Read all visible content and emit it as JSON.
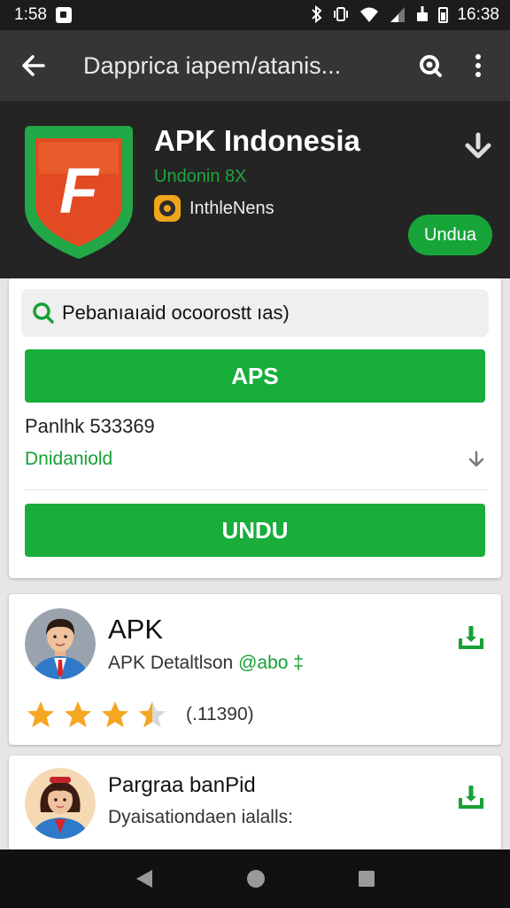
{
  "status_bar": {
    "time_left": "1:58",
    "time_right": "16:38",
    "icons": [
      "notification-icon",
      "bluetooth-icon",
      "vibrate-icon",
      "wifi-icon",
      "signal-icon",
      "battery-icon"
    ]
  },
  "app_bar": {
    "title": "Dapprica iapem/atanis...",
    "icons": [
      "back-arrow-icon",
      "search-icon",
      "more-vert-icon"
    ]
  },
  "header": {
    "app_name": "APK Indonesia",
    "subline": "Undonin 8X",
    "developer": "InthleNens",
    "install_button": "Undua",
    "logo_letter": "F",
    "colors": {
      "background": "#242424",
      "accent": "#17a53a"
    }
  },
  "main_card": {
    "search_text": "Pebanıaıaid ocoorostt ıas)",
    "primary_button": "APS",
    "package_text": "Panlhk 533369",
    "download_label": "Dnidaniold",
    "download_button": "UNDU"
  },
  "list": [
    {
      "title": "APK",
      "subtitle_prefix": "APK Detaltlson ",
      "subtitle_highlight": "@abo ‡",
      "rating": 3.5,
      "rating_count": "(.11390)"
    },
    {
      "title": "Pargraa banPid",
      "subtitle": "Dyaisationdaen ialalls:"
    }
  ],
  "colors": {
    "green": "#19ad3c",
    "star": "#f5a623"
  }
}
